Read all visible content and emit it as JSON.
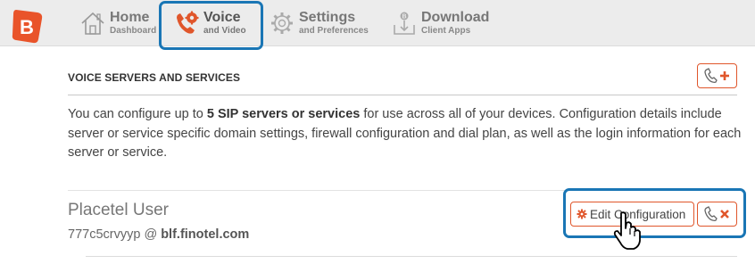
{
  "nav": {
    "items": [
      {
        "title": "Home",
        "subtitle": "Dashboard",
        "icon": "home-icon"
      },
      {
        "title": "Voice",
        "subtitle": "and Video",
        "icon": "phone-gear-icon",
        "active": true
      },
      {
        "title": "Settings",
        "subtitle": "and Preferences",
        "icon": "gear-icon"
      },
      {
        "title": "Download",
        "subtitle": "Client Apps",
        "icon": "download-icon"
      }
    ]
  },
  "section": {
    "title": "VOICE SERVERS AND SERVICES",
    "description_pre": "You can configure up to ",
    "description_bold": "5 SIP servers or services",
    "description_post": " for use across all of your devices. Configuration details include server or service specific domain settings, firewall configuration and dial plan, as well as the login information for each server or service."
  },
  "server": {
    "name": "Placetel User",
    "user": "777c5crvyyp",
    "at": "@",
    "domain": "blf.finotel.com",
    "edit_label": "Edit Configuration"
  },
  "colors": {
    "accent": "#e0562b",
    "highlight": "#1a76b5",
    "topbar": "#ececec"
  }
}
